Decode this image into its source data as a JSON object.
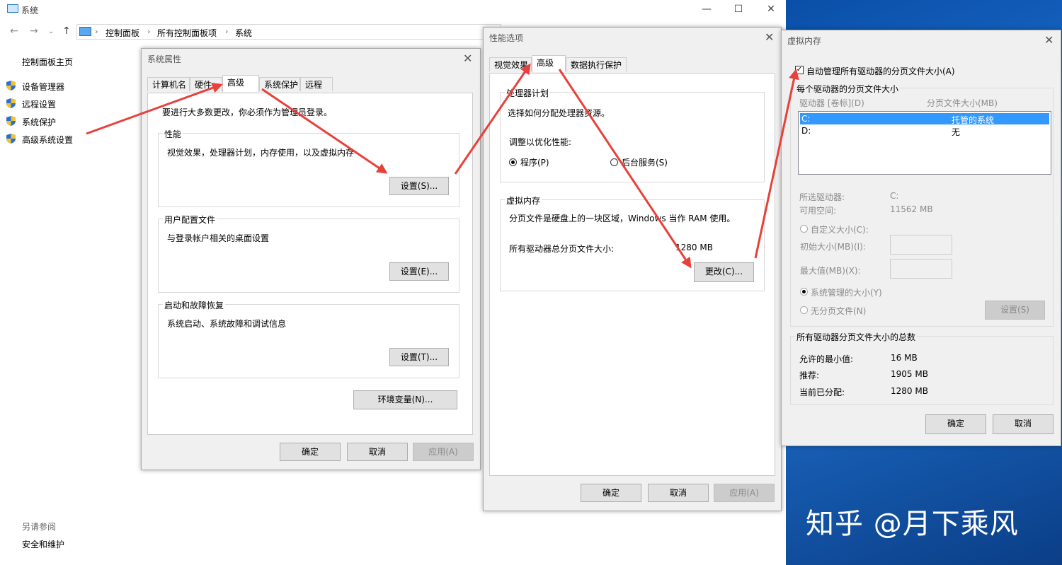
{
  "main": {
    "title": "系统",
    "breadcrumb": [
      "控制面板",
      "所有控制面板项",
      "系统"
    ],
    "sidebar": {
      "home": "控制面板主页",
      "links": [
        "设备管理器",
        "远程设置",
        "系统保护",
        "高级系统设置"
      ],
      "see_also_title": "另请参阅",
      "see_also_link": "安全和维护"
    }
  },
  "sysprops": {
    "title": "系统属性",
    "tabs": [
      "计算机名",
      "硬件",
      "高级",
      "系统保护",
      "远程"
    ],
    "active_tab": "高级",
    "admin_note": "要进行大多数更改，你必须作为管理员登录。",
    "performance": {
      "label": "性能",
      "desc": "视觉效果，处理器计划，内存使用，以及虚拟内存",
      "button": "设置(S)..."
    },
    "profile": {
      "label": "用户配置文件",
      "desc": "与登录帐户相关的桌面设置",
      "button": "设置(E)..."
    },
    "startup": {
      "label": "启动和故障恢复",
      "desc": "系统启动、系统故障和调试信息",
      "button": "设置(T)..."
    },
    "env_button": "环境变量(N)...",
    "ok": "确定",
    "cancel": "取消",
    "apply": "应用(A)"
  },
  "perf": {
    "title": "性能选项",
    "tabs": [
      "视觉效果",
      "高级",
      "数据执行保护"
    ],
    "active_tab": "高级",
    "cpu": {
      "label": "处理器计划",
      "desc": "选择如何分配处理器资源。",
      "optimize": "调整以优化性能:",
      "opt_programs": "程序(P)",
      "opt_background": "后台服务(S)"
    },
    "vm": {
      "label": "虚拟内存",
      "desc": "分页文件是硬盘上的一块区域，Windows 当作 RAM 使用。",
      "total_label": "所有驱动器总分页文件大小:",
      "total_value": "1280 MB",
      "change_button": "更改(C)..."
    },
    "ok": "确定",
    "cancel": "取消",
    "apply": "应用(A)"
  },
  "vmem": {
    "title": "虚拟内存",
    "auto_manage": "自动管理所有驱动器的分页文件大小(A)",
    "auto_manage_checked": true,
    "per_drive_label": "每个驱动器的分页文件大小",
    "col_drive": "驱动器 [卷标](D)",
    "col_size": "分页文件大小(MB)",
    "drives": [
      {
        "drive": "C:",
        "size": "托管的系统"
      },
      {
        "drive": "D:",
        "size": "无"
      }
    ],
    "selected_drive_label": "所选驱动器:",
    "selected_drive_value": "C:",
    "free_space_label": "可用空间:",
    "free_space_value": "11562 MB",
    "custom_size": "自定义大小(C):",
    "initial_size": "初始大小(MB)(I):",
    "max_size": "最大值(MB)(X):",
    "system_managed": "系统管理的大小(Y)",
    "no_paging": "无分页文件(N)",
    "set_button": "设置(S)",
    "totals_label": "所有驱动器分页文件大小的总数",
    "min_allowed_label": "允许的最小值:",
    "min_allowed_value": "16 MB",
    "recommended_label": "推荐:",
    "recommended_value": "1905 MB",
    "allocated_label": "当前已分配:",
    "allocated_value": "1280 MB",
    "ok": "确定",
    "cancel": "取消"
  },
  "watermark": "知乎 @月下乘风",
  "colors": {
    "arrow": "#e8403a",
    "selection": "#3399ff",
    "desktop": "#1f74d4"
  }
}
